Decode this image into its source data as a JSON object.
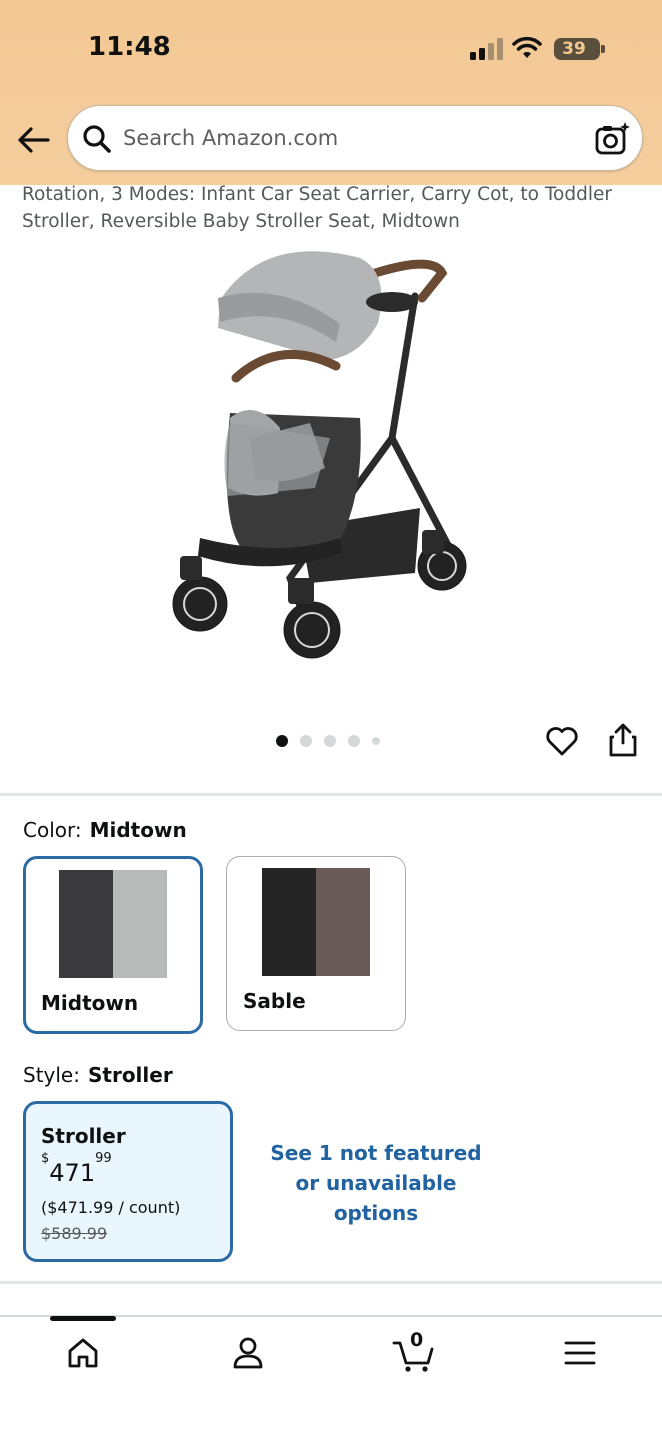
{
  "status_bar": {
    "time": "11:48",
    "battery": "39"
  },
  "search": {
    "placeholder": "Search Amazon.com"
  },
  "product": {
    "title": "Rotation, 3 Modes: Infant Car Seat Carrier, Carry Cot, to Toddler Stroller, Reversible Baby Stroller Seat, Midtown",
    "image_count": 5,
    "active_image": 0
  },
  "color_selector": {
    "label": "Color:",
    "selected": "Midtown",
    "options": [
      {
        "name": "Midtown",
        "colors": [
          "#3a3a3c",
          "#b9bbbb"
        ]
      },
      {
        "name": "Sable",
        "colors": [
          "#252526",
          "#6a5a58"
        ]
      }
    ]
  },
  "style_selector": {
    "label": "Style:",
    "selected": "Stroller",
    "option": {
      "name": "Stroller",
      "price_symbol": "$",
      "price_whole": "471",
      "price_fraction": "99",
      "per_count": "($471.99 / count)",
      "list_price": "$589.99"
    },
    "see_more": "See 1 not featured or unavailable options"
  },
  "bottom_nav": {
    "cart_count": "0",
    "items": [
      "home-icon",
      "account-icon",
      "cart-icon",
      "menu-icon"
    ]
  }
}
